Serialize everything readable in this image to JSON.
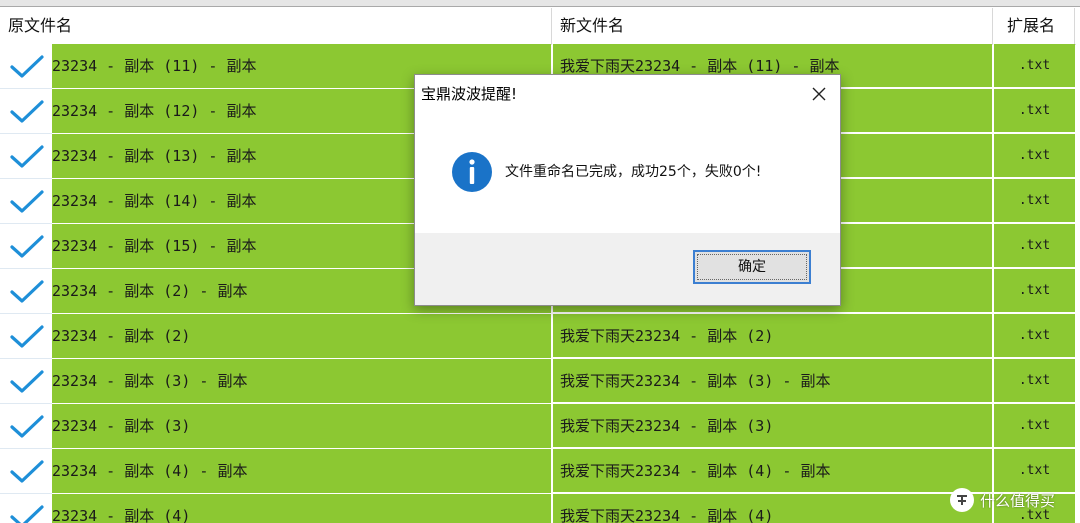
{
  "columns": {
    "original": "原文件名",
    "new": "新文件名",
    "ext": "扩展名"
  },
  "rows": [
    {
      "original": "23234 - 副本 (11) - 副本",
      "new": "我爱下雨天23234 - 副本 (11) - 副本",
      "ext": ".txt"
    },
    {
      "original": "23234 - 副本 (12) - 副本",
      "new": "",
      "ext": ".txt"
    },
    {
      "original": "23234 - 副本 (13) - 副本",
      "new": "",
      "ext": ".txt"
    },
    {
      "original": "23234 - 副本 (14) - 副本",
      "new": "",
      "ext": ".txt"
    },
    {
      "original": "23234 - 副本 (15) - 副本",
      "new": "",
      "ext": ".txt"
    },
    {
      "original": "23234 - 副本 (2) - 副本",
      "new": "",
      "ext": ".txt"
    },
    {
      "original": "23234 - 副本 (2)",
      "new": "我爱下雨天23234 - 副本 (2)",
      "ext": ".txt"
    },
    {
      "original": "23234 - 副本 (3) - 副本",
      "new": "我爱下雨天23234 - 副本 (3) - 副本",
      "ext": ".txt"
    },
    {
      "original": "23234 - 副本 (3)",
      "new": "我爱下雨天23234 - 副本 (3)",
      "ext": ".txt"
    },
    {
      "original": "23234 - 副本 (4) - 副本",
      "new": "我爱下雨天23234 - 副本 (4) - 副本",
      "ext": ".txt"
    },
    {
      "original": "23234 - 副本 (4)",
      "new": "我爱下雨天23234 - 副本 (4)",
      "ext": ".txt"
    }
  ],
  "dialog": {
    "title": "宝鼎波波提醒!",
    "message": "文件重命名已完成，成功25个，失败0个!",
    "ok_label": "确定"
  },
  "watermark": {
    "text": "什么值得买",
    "icon": "zhi-logo-icon"
  },
  "colors": {
    "row_fill": "#8cc832",
    "check": "#1e8fd8",
    "info_icon": "#1a73c8"
  }
}
